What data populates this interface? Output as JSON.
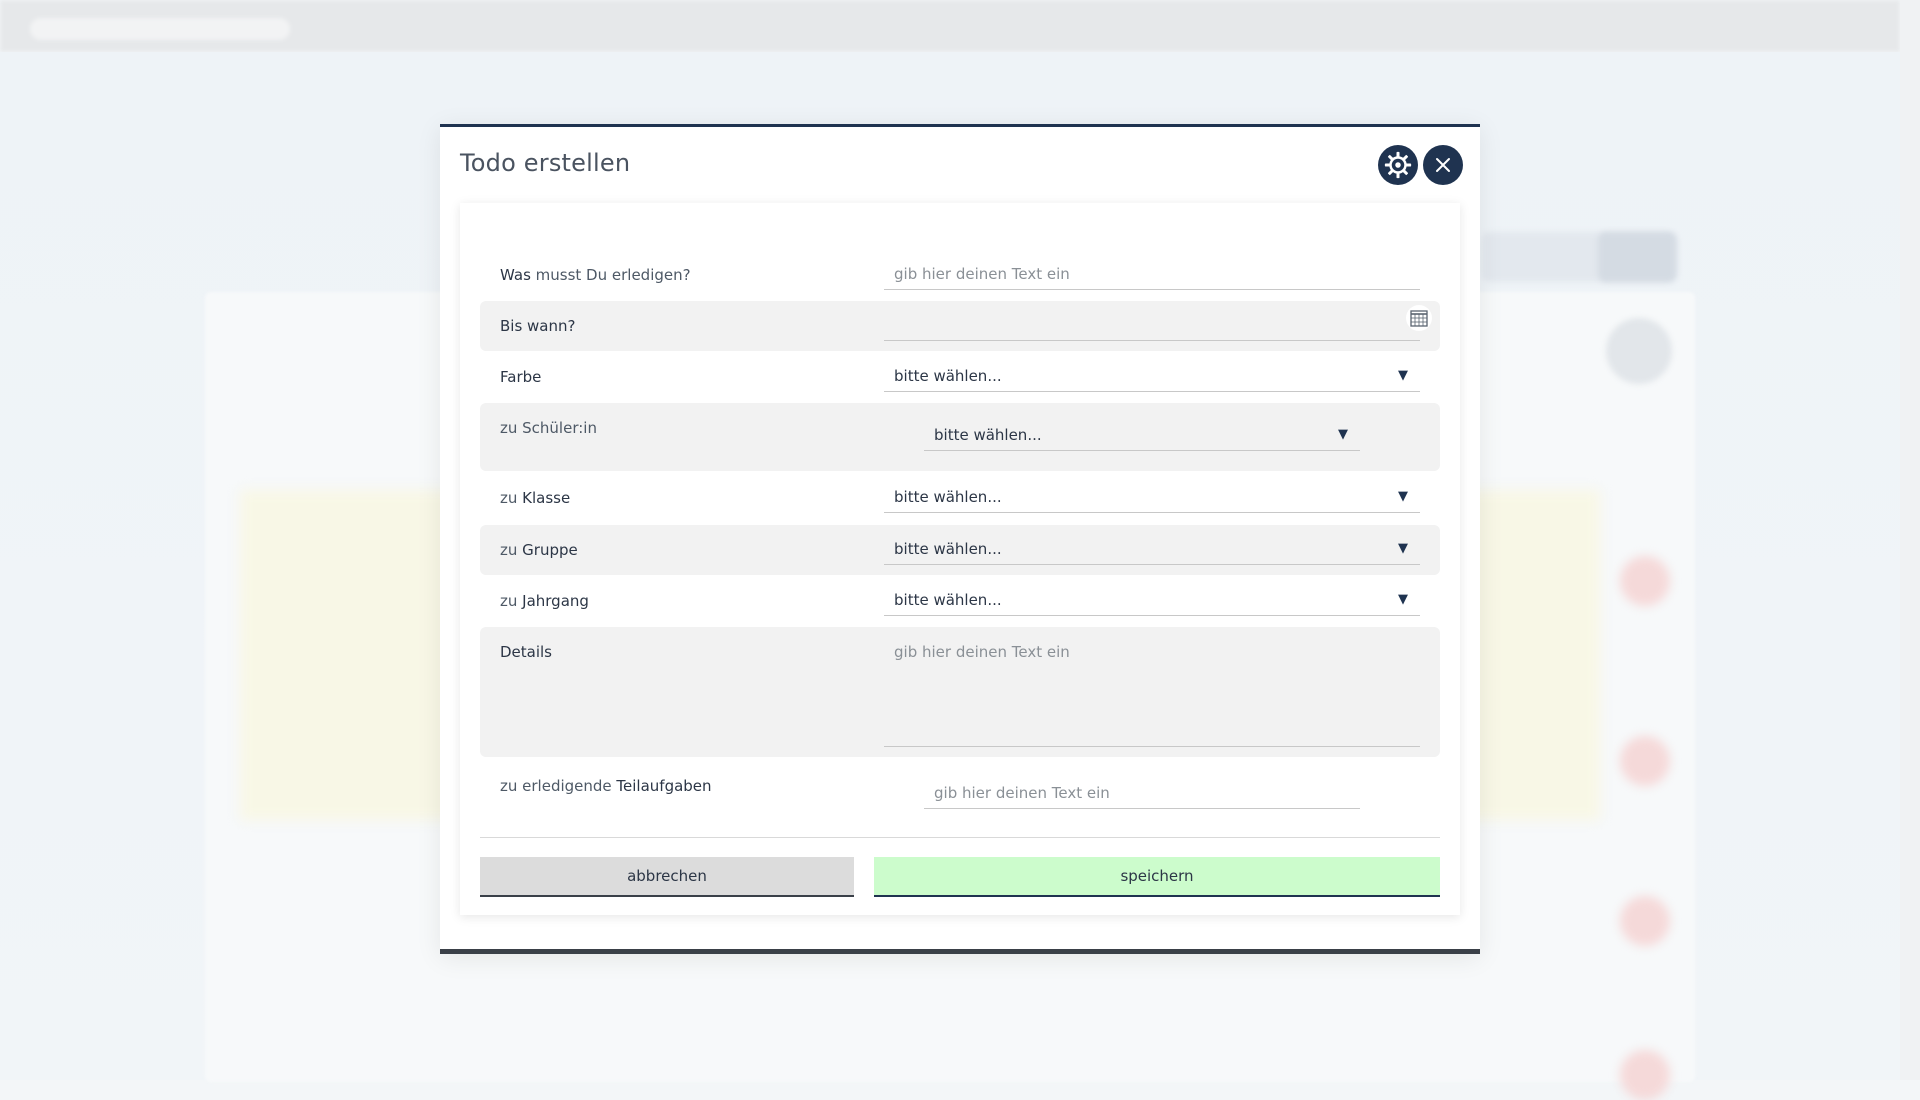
{
  "dialog": {
    "title": "Todo erstellen",
    "settings_icon": "gear-icon",
    "close_icon": "close-icon"
  },
  "form": {
    "what": {
      "label_strong": "Was",
      "label_rest": " musst Du erledigen?",
      "placeholder": "gib hier deinen Text ein"
    },
    "due": {
      "label": "Bis wann?",
      "value": "",
      "icon": "calendar-icon"
    },
    "color": {
      "label": "Farbe",
      "value": "bitte wählen..."
    },
    "student": {
      "label": "zu Schüler:in",
      "value": "bitte wählen..."
    },
    "class": {
      "label_prefix": "zu ",
      "label_strong": "Klasse",
      "value": "bitte wählen..."
    },
    "group": {
      "label_prefix": "zu ",
      "label_strong": "Gruppe",
      "value": "bitte wählen..."
    },
    "year": {
      "label_prefix": "zu ",
      "label_strong": "Jahrgang",
      "value": "bitte wählen..."
    },
    "details": {
      "label": "Details",
      "placeholder": "gib hier deinen Text ein"
    },
    "subtasks": {
      "label_prefix": "zu erledigende ",
      "label_strong": "Teilaufgaben",
      "placeholder": "gib hier deinen Text ein"
    }
  },
  "actions": {
    "cancel_label": "abbrechen",
    "save_label": "speichern"
  },
  "colors": {
    "primary": "#1f3350",
    "save_bg": "#ccfccc",
    "cancel_bg": "#dcdcdc"
  }
}
